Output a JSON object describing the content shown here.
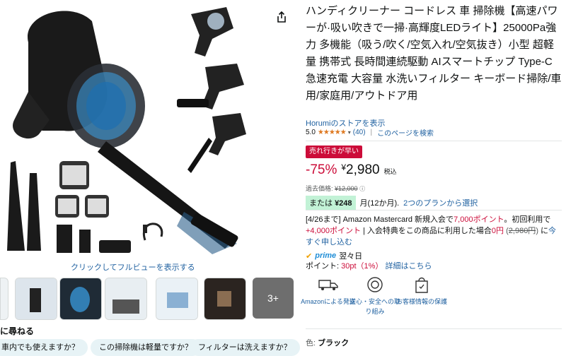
{
  "gallery": {
    "zoom_text": "クリックしてフルビューを表示する",
    "more_count": "3+",
    "ask_title": "に尋ねる",
    "questions": [
      "車内でも使えますか？",
      "この掃除機は軽量ですか？",
      "フィルターは洗えますか？"
    ]
  },
  "product": {
    "title": "ハンディクリーナー コードレス 車 掃除機【高速パワーが·吸い吹きで一掃·高輝度LEDライト】25000Pa強力 多機能（吸う/吹く/空気入れ/空気抜き）小型 超軽量 携帯式 長時間連続駆動 AIスマートチップ Type-C急速充電 大容量 水洗いフィルター キーボード掃除/車用/家庭用/アウトドア用",
    "store_link": "Horumiのストアを表示",
    "rating_value": "5.0",
    "stars": "★★★★★",
    "rating_count": "(40)",
    "search_page": "このページを検索"
  },
  "pricing": {
    "deal_badge": "売れ行きが早い",
    "discount": "-75%",
    "currency": "¥",
    "price": "2,980",
    "tax_label": "税込",
    "list_label": "過去価格:",
    "list_price": "¥12,000",
    "installment_prefix": "または",
    "installment_amount": "¥248",
    "installment_months": "月(12か月).",
    "installment_link": "2つのプランから選択"
  },
  "promo": {
    "lead": "[4/26まで] Amazon Mastercard 新規入会で",
    "points_1": "7,000ポイント",
    "mid_1": "。初回利用で",
    "points_2": "+4,000ポイント",
    "mid_2": " | 入会特典をこの商品に利用した場合",
    "zero_price": "0円",
    "old_price": "2,980円",
    "tail": "に",
    "link": "今すぐ申し込む"
  },
  "shipping": {
    "prime": "prime",
    "delivery": "翌々日",
    "points_label": "ポイント:",
    "points_value": "30pt（1%）",
    "points_link": "詳細はこちら"
  },
  "features": [
    {
      "label": "Amazonによる発送",
      "icon": "truck-icon"
    },
    {
      "label": "安心・安全への取り組み",
      "icon": "badge-icon"
    },
    {
      "label": "お客様情報の保護",
      "icon": "lock-bag-icon"
    }
  ],
  "variant": {
    "color_label": "色:",
    "color_value": "ブラック"
  },
  "colors": {
    "link": "#2162a1",
    "deal": "#cc0c39",
    "star": "#de7921",
    "installment_bg": "#c2f2d6"
  }
}
